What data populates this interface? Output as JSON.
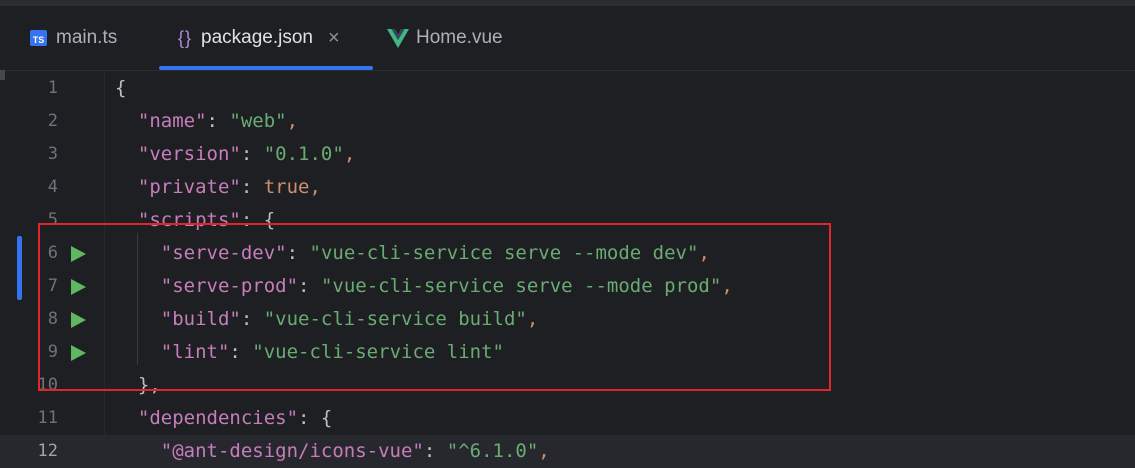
{
  "tabs": [
    {
      "icon": "typescript-file-icon",
      "icon_text": "TS",
      "label": "main.ts",
      "active": false
    },
    {
      "icon": "json-file-icon",
      "icon_text": "{}",
      "label": "package.json",
      "active": true,
      "close": "×"
    },
    {
      "icon": "vue-file-icon",
      "label": "Home.vue",
      "active": false
    }
  ],
  "lines": [
    {
      "n": "1"
    },
    {
      "n": "2"
    },
    {
      "n": "3"
    },
    {
      "n": "4"
    },
    {
      "n": "5"
    },
    {
      "n": "6"
    },
    {
      "n": "7"
    },
    {
      "n": "8"
    },
    {
      "n": "9"
    },
    {
      "n": "10"
    },
    {
      "n": "11"
    },
    {
      "n": "12"
    }
  ],
  "code": {
    "l1_open": "{",
    "name_key": "\"name\"",
    "name_val": "\"web\"",
    "version_key": "\"version\"",
    "version_val": "\"0.1.0\"",
    "private_key": "\"private\"",
    "private_val": "true",
    "scripts_key": "\"scripts\"",
    "serve_dev_key": "\"serve-dev\"",
    "serve_dev_val": "\"vue-cli-service serve --mode dev\"",
    "serve_prod_key": "\"serve-prod\"",
    "serve_prod_val": "\"vue-cli-service serve --mode prod\"",
    "build_key": "\"build\"",
    "build_val": "\"vue-cli-service build\"",
    "lint_key": "\"lint\"",
    "lint_val": "\"vue-cli-service lint\"",
    "scripts_close": "},",
    "deps_key": "\"dependencies\"",
    "antd_key": "\"@ant-design/icons-vue\"",
    "antd_val": "\"^6.1.0\""
  },
  "colors": {
    "accent": "#3574f0",
    "highlight_box": "#e0262c",
    "run_icon": "#5fb85f",
    "string": "#6aab73",
    "key": "#c77dbb",
    "keyword": "#cf8e6d"
  },
  "current_line": "12",
  "run_lines": [
    "6",
    "7",
    "8",
    "9"
  ]
}
